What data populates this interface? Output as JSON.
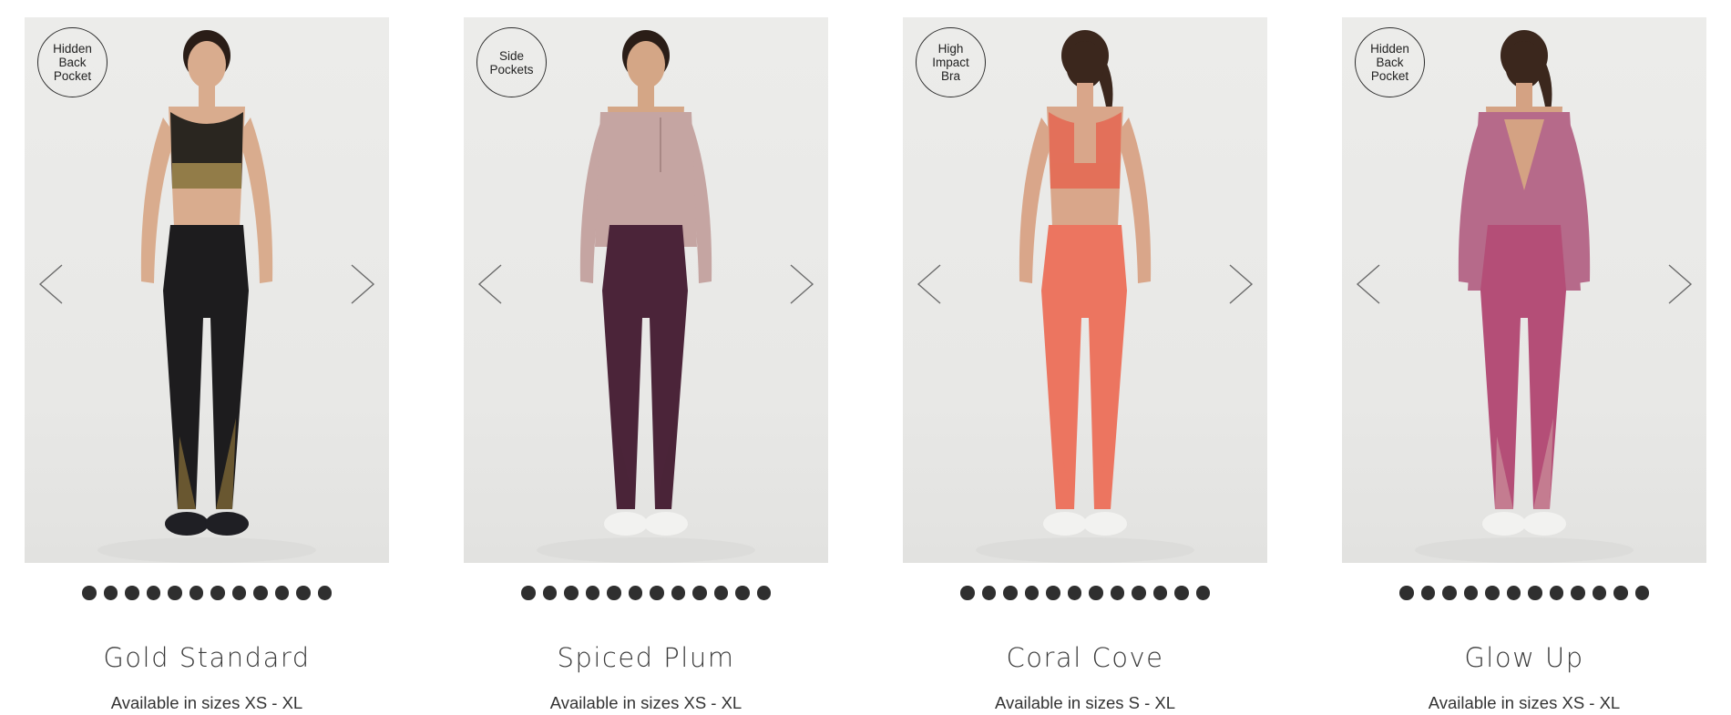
{
  "products": [
    {
      "badge": "Hidden\nBack\nPocket",
      "name": "Gold Standard",
      "sizes": "Available in sizes XS - XL",
      "colors": {
        "top": "#2a2620",
        "top_sheen": "#b59a55",
        "bottom": "#1d1c1e",
        "bottom_sheen": "#a8893f",
        "shoes": "#1f1f24",
        "skin": "#d9ac8e",
        "hair": "#2a1d17"
      },
      "view": "front",
      "dot_count": 12
    },
    {
      "badge": "Side\nPockets",
      "name": "Spiced Plum",
      "sizes": "Available in sizes XS - XL",
      "colors": {
        "top": "#c5a5a2",
        "top_sheen": "#b89390",
        "bottom": "#4b2439",
        "bottom_sheen": "#4b2439",
        "shoes": "#f2f2f0",
        "skin": "#d4a686",
        "hair": "#2a1d17"
      },
      "view": "front",
      "dot_count": 12
    },
    {
      "badge": "High\nImpact\nBra",
      "name": "Coral Cove",
      "sizes": "Available in sizes S - XL",
      "colors": {
        "top": "#e3705a",
        "top_sheen": "#e3705a",
        "bottom": "#ec7560",
        "bottom_sheen": "#ec7560",
        "shoes": "#f2f2f0",
        "skin": "#d9a68a",
        "hair": "#3b271d"
      },
      "view": "back",
      "dot_count": 12
    },
    {
      "badge": "Hidden\nBack\nPocket",
      "name": "Glow Up",
      "sizes": "Available in sizes XS - XL",
      "colors": {
        "top": "#b66a8a",
        "top_sheen": "#a85b7d",
        "bottom": "#b44e77",
        "bottom_sheen": "#d2a2a5",
        "shoes": "#f2f2f0",
        "skin": "#d4a283",
        "hair": "#3b271d"
      },
      "view": "back",
      "dot_count": 12
    }
  ],
  "icons": {
    "prev": "chevron-left-icon",
    "next": "chevron-right-icon"
  }
}
